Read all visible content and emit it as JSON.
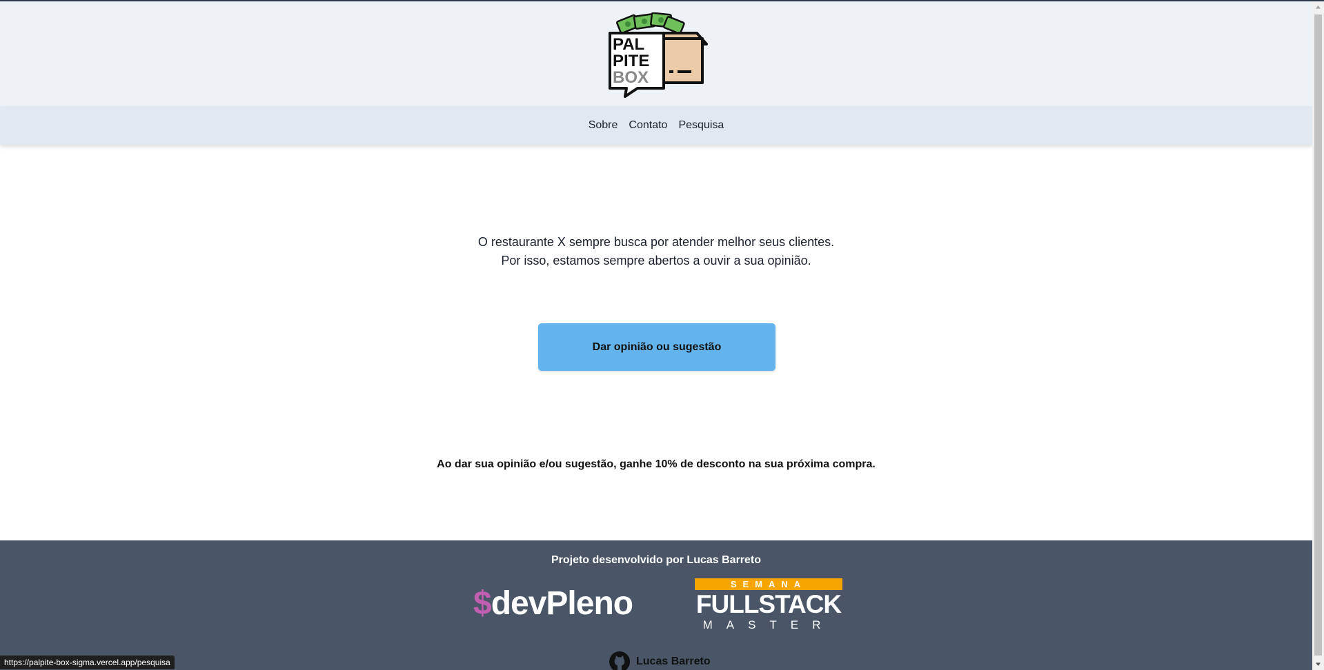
{
  "header": {
    "logo_lines": [
      "PAL",
      "PITE",
      "BOX"
    ]
  },
  "nav": {
    "items": [
      {
        "label": "Sobre"
      },
      {
        "label": "Contato"
      },
      {
        "label": "Pesquisa"
      }
    ]
  },
  "main": {
    "intro_line1": "O restaurante X sempre busca por atender melhor seus clientes.",
    "intro_line2": "Por isso, estamos sempre abertos a ouvir a sua opinião.",
    "cta_label": "Dar opinião ou sugestão",
    "promo": "Ao dar sua opinião e/ou sugestão, ganhe 10% de desconto na sua próxima compra."
  },
  "footer": {
    "credit": "Projeto desenvolvido por Lucas Barreto",
    "devpleno_symbol": "$",
    "devpleno_text": "devPleno",
    "fullstack_top": "SEMANA",
    "fullstack_middle": "FULLSTACK",
    "fullstack_bottom": "MASTER",
    "github_name": "Lucas Barreto"
  },
  "statusbar": {
    "url": "https://palpite-box-sigma.vercel.app/pesquisa"
  },
  "colors": {
    "header_bg": "#edf2f7",
    "nav_bg": "#e2e8f0",
    "cta_bg": "#63b3ed",
    "footer_bg": "#4a5568",
    "devpleno_accent": "#c05fb0",
    "fullstack_accent": "#f6a500"
  },
  "icons": {
    "logo": "palpite-box-logo",
    "github": "github-icon"
  }
}
